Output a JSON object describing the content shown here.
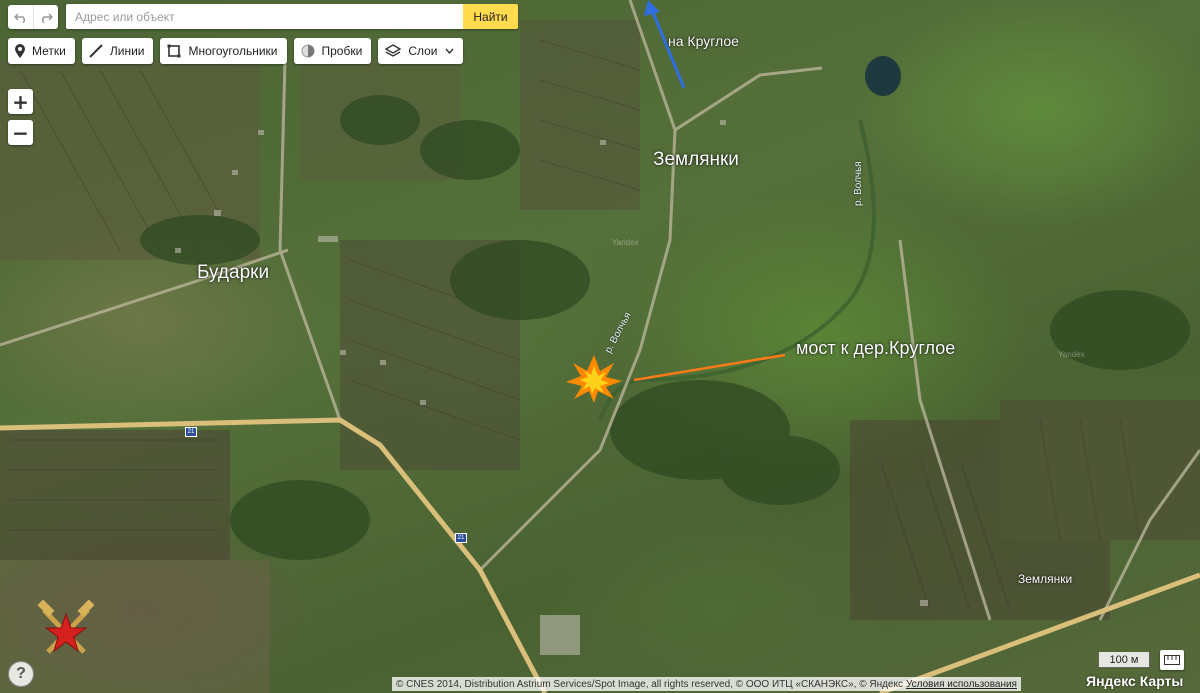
{
  "search": {
    "placeholder": "Адрес или объект",
    "button_label": "Найти"
  },
  "toolbar": {
    "undo_icon": "undo-icon",
    "redo_icon": "redo-icon",
    "tools": [
      {
        "label": "Метки",
        "icon": "placemark-icon"
      },
      {
        "label": "Линии",
        "icon": "line-icon"
      },
      {
        "label": "Многоугольники",
        "icon": "polygon-icon"
      },
      {
        "label": "Пробки",
        "icon": "traffic-icon"
      },
      {
        "label": "Слои",
        "icon": "layers-icon"
      }
    ]
  },
  "zoom": {
    "in_label": "+",
    "out_label": "−"
  },
  "map": {
    "labels": {
      "zemlyanki": "Землянки",
      "budarki": "Бударки",
      "bridge": "мост к дер.Круглое",
      "to_krugloe": "на Круглое",
      "zemlyanki_small": "Землянки"
    },
    "rivers": {
      "volchya_1": "р. Волчья",
      "volchya_2": "р. Волчья"
    },
    "watermark": "Yandex",
    "road_badge": "21",
    "annotation_colors": {
      "bridge_line": "#ff7a1a",
      "direction_arrow": "#2f6fe0",
      "explosion": "#ffb000"
    }
  },
  "scale": {
    "label": "100 м"
  },
  "copyright": {
    "text": "© CNES 2014, Distribution Astrium Services/Spot Image, all rights reserved, © ООО ИТЦ «СКАНЭКС», © Яндекс",
    "terms": "Условия использования"
  },
  "brand": "Яндекс Карты",
  "help_label": "?"
}
